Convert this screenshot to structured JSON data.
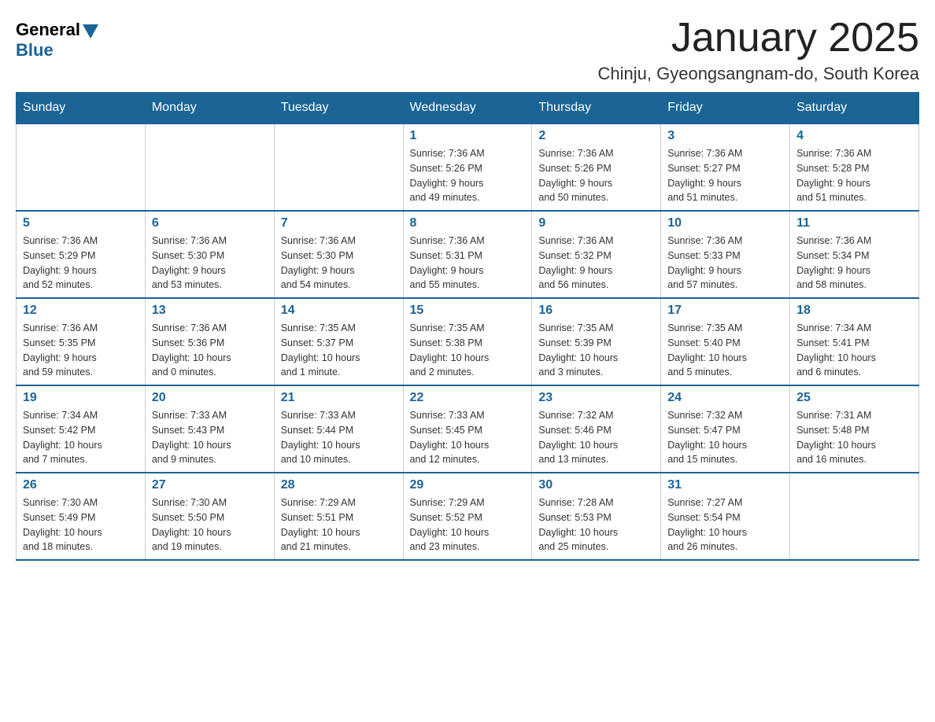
{
  "logo": {
    "general": "General",
    "blue": "Blue"
  },
  "header": {
    "month": "January 2025",
    "location": "Chinju, Gyeongsangnam-do, South Korea"
  },
  "days_of_week": [
    "Sunday",
    "Monday",
    "Tuesday",
    "Wednesday",
    "Thursday",
    "Friday",
    "Saturday"
  ],
  "weeks": [
    [
      {
        "day": "",
        "info": ""
      },
      {
        "day": "",
        "info": ""
      },
      {
        "day": "",
        "info": ""
      },
      {
        "day": "1",
        "info": "Sunrise: 7:36 AM\nSunset: 5:26 PM\nDaylight: 9 hours\nand 49 minutes."
      },
      {
        "day": "2",
        "info": "Sunrise: 7:36 AM\nSunset: 5:26 PM\nDaylight: 9 hours\nand 50 minutes."
      },
      {
        "day": "3",
        "info": "Sunrise: 7:36 AM\nSunset: 5:27 PM\nDaylight: 9 hours\nand 51 minutes."
      },
      {
        "day": "4",
        "info": "Sunrise: 7:36 AM\nSunset: 5:28 PM\nDaylight: 9 hours\nand 51 minutes."
      }
    ],
    [
      {
        "day": "5",
        "info": "Sunrise: 7:36 AM\nSunset: 5:29 PM\nDaylight: 9 hours\nand 52 minutes."
      },
      {
        "day": "6",
        "info": "Sunrise: 7:36 AM\nSunset: 5:30 PM\nDaylight: 9 hours\nand 53 minutes."
      },
      {
        "day": "7",
        "info": "Sunrise: 7:36 AM\nSunset: 5:30 PM\nDaylight: 9 hours\nand 54 minutes."
      },
      {
        "day": "8",
        "info": "Sunrise: 7:36 AM\nSunset: 5:31 PM\nDaylight: 9 hours\nand 55 minutes."
      },
      {
        "day": "9",
        "info": "Sunrise: 7:36 AM\nSunset: 5:32 PM\nDaylight: 9 hours\nand 56 minutes."
      },
      {
        "day": "10",
        "info": "Sunrise: 7:36 AM\nSunset: 5:33 PM\nDaylight: 9 hours\nand 57 minutes."
      },
      {
        "day": "11",
        "info": "Sunrise: 7:36 AM\nSunset: 5:34 PM\nDaylight: 9 hours\nand 58 minutes."
      }
    ],
    [
      {
        "day": "12",
        "info": "Sunrise: 7:36 AM\nSunset: 5:35 PM\nDaylight: 9 hours\nand 59 minutes."
      },
      {
        "day": "13",
        "info": "Sunrise: 7:36 AM\nSunset: 5:36 PM\nDaylight: 10 hours\nand 0 minutes."
      },
      {
        "day": "14",
        "info": "Sunrise: 7:35 AM\nSunset: 5:37 PM\nDaylight: 10 hours\nand 1 minute."
      },
      {
        "day": "15",
        "info": "Sunrise: 7:35 AM\nSunset: 5:38 PM\nDaylight: 10 hours\nand 2 minutes."
      },
      {
        "day": "16",
        "info": "Sunrise: 7:35 AM\nSunset: 5:39 PM\nDaylight: 10 hours\nand 3 minutes."
      },
      {
        "day": "17",
        "info": "Sunrise: 7:35 AM\nSunset: 5:40 PM\nDaylight: 10 hours\nand 5 minutes."
      },
      {
        "day": "18",
        "info": "Sunrise: 7:34 AM\nSunset: 5:41 PM\nDaylight: 10 hours\nand 6 minutes."
      }
    ],
    [
      {
        "day": "19",
        "info": "Sunrise: 7:34 AM\nSunset: 5:42 PM\nDaylight: 10 hours\nand 7 minutes."
      },
      {
        "day": "20",
        "info": "Sunrise: 7:33 AM\nSunset: 5:43 PM\nDaylight: 10 hours\nand 9 minutes."
      },
      {
        "day": "21",
        "info": "Sunrise: 7:33 AM\nSunset: 5:44 PM\nDaylight: 10 hours\nand 10 minutes."
      },
      {
        "day": "22",
        "info": "Sunrise: 7:33 AM\nSunset: 5:45 PM\nDaylight: 10 hours\nand 12 minutes."
      },
      {
        "day": "23",
        "info": "Sunrise: 7:32 AM\nSunset: 5:46 PM\nDaylight: 10 hours\nand 13 minutes."
      },
      {
        "day": "24",
        "info": "Sunrise: 7:32 AM\nSunset: 5:47 PM\nDaylight: 10 hours\nand 15 minutes."
      },
      {
        "day": "25",
        "info": "Sunrise: 7:31 AM\nSunset: 5:48 PM\nDaylight: 10 hours\nand 16 minutes."
      }
    ],
    [
      {
        "day": "26",
        "info": "Sunrise: 7:30 AM\nSunset: 5:49 PM\nDaylight: 10 hours\nand 18 minutes."
      },
      {
        "day": "27",
        "info": "Sunrise: 7:30 AM\nSunset: 5:50 PM\nDaylight: 10 hours\nand 19 minutes."
      },
      {
        "day": "28",
        "info": "Sunrise: 7:29 AM\nSunset: 5:51 PM\nDaylight: 10 hours\nand 21 minutes."
      },
      {
        "day": "29",
        "info": "Sunrise: 7:29 AM\nSunset: 5:52 PM\nDaylight: 10 hours\nand 23 minutes."
      },
      {
        "day": "30",
        "info": "Sunrise: 7:28 AM\nSunset: 5:53 PM\nDaylight: 10 hours\nand 25 minutes."
      },
      {
        "day": "31",
        "info": "Sunrise: 7:27 AM\nSunset: 5:54 PM\nDaylight: 10 hours\nand 26 minutes."
      },
      {
        "day": "",
        "info": ""
      }
    ]
  ]
}
